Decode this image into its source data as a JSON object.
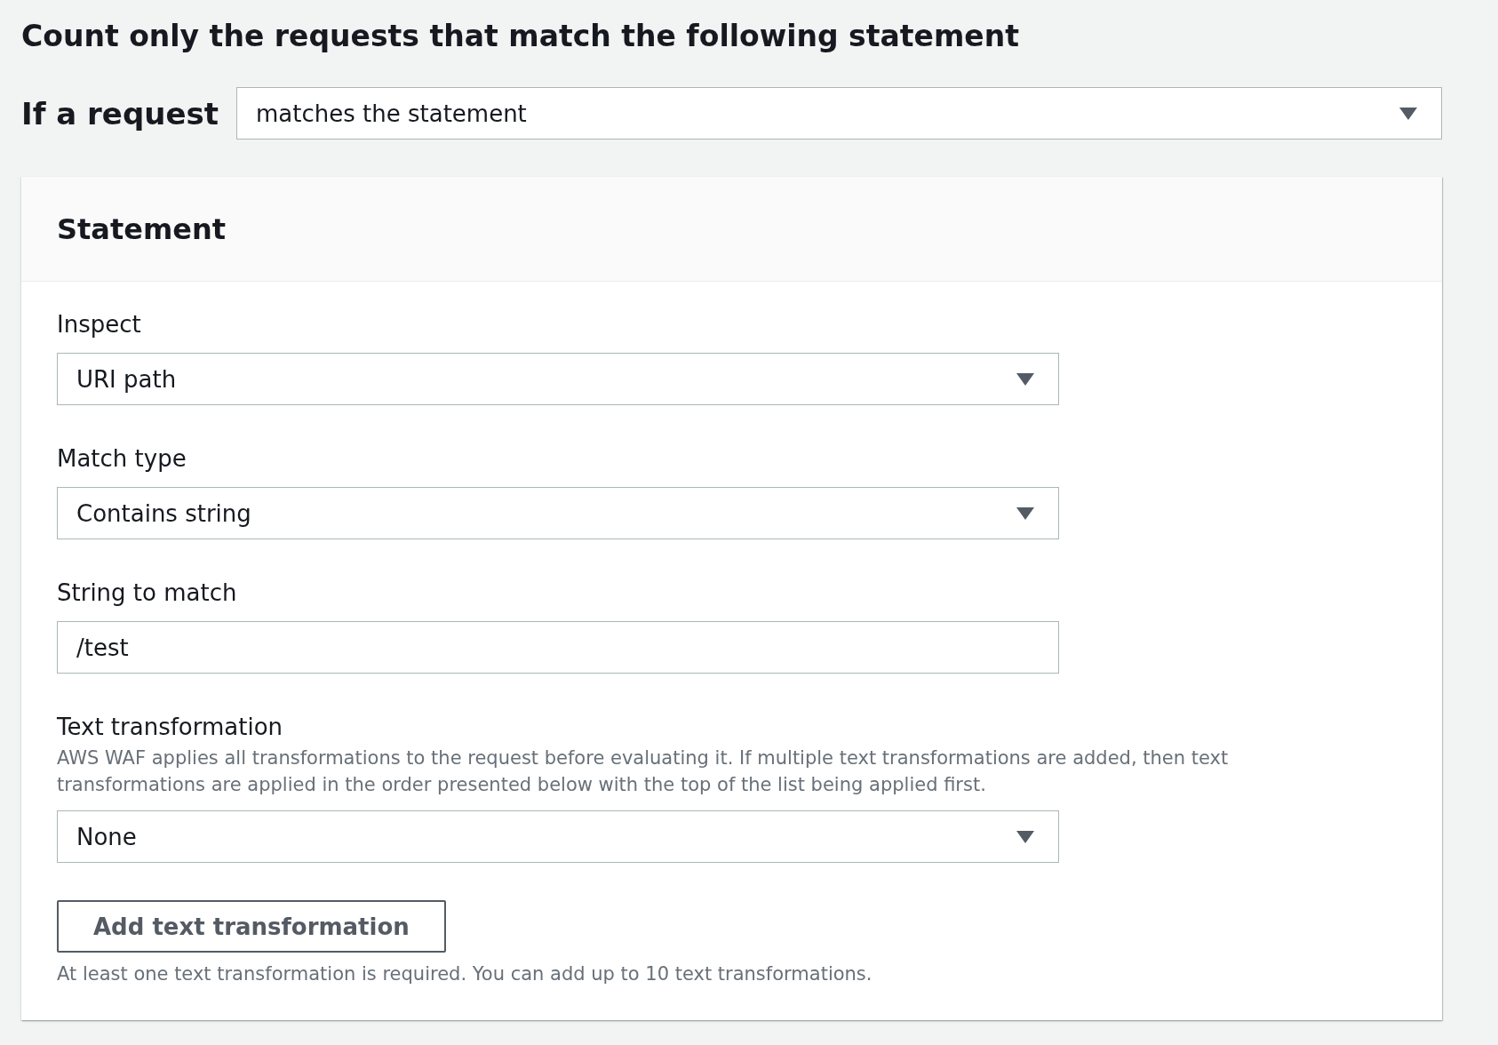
{
  "heading": "Count only the requests that match the following statement",
  "condition": {
    "label": "If a request",
    "value": "matches the statement"
  },
  "statement": {
    "title": "Statement",
    "fields": [
      {
        "kind": "select",
        "label": "Inspect",
        "value": "URI path"
      },
      {
        "kind": "select",
        "label": "Match type",
        "value": "Contains string"
      },
      {
        "kind": "input",
        "label": "String to match",
        "value": "/test"
      },
      {
        "kind": "select",
        "label": "Text transformation",
        "description": "AWS WAF applies all transformations to the request before evaluating it. If multiple text transformations are added, then text transformations are applied in the order presented below with the top of the list being applied first.",
        "value": "None"
      }
    ],
    "button": "Add text transformation",
    "footnote": "At least one text transformation is required. You can add up to 10 text transformations."
  }
}
